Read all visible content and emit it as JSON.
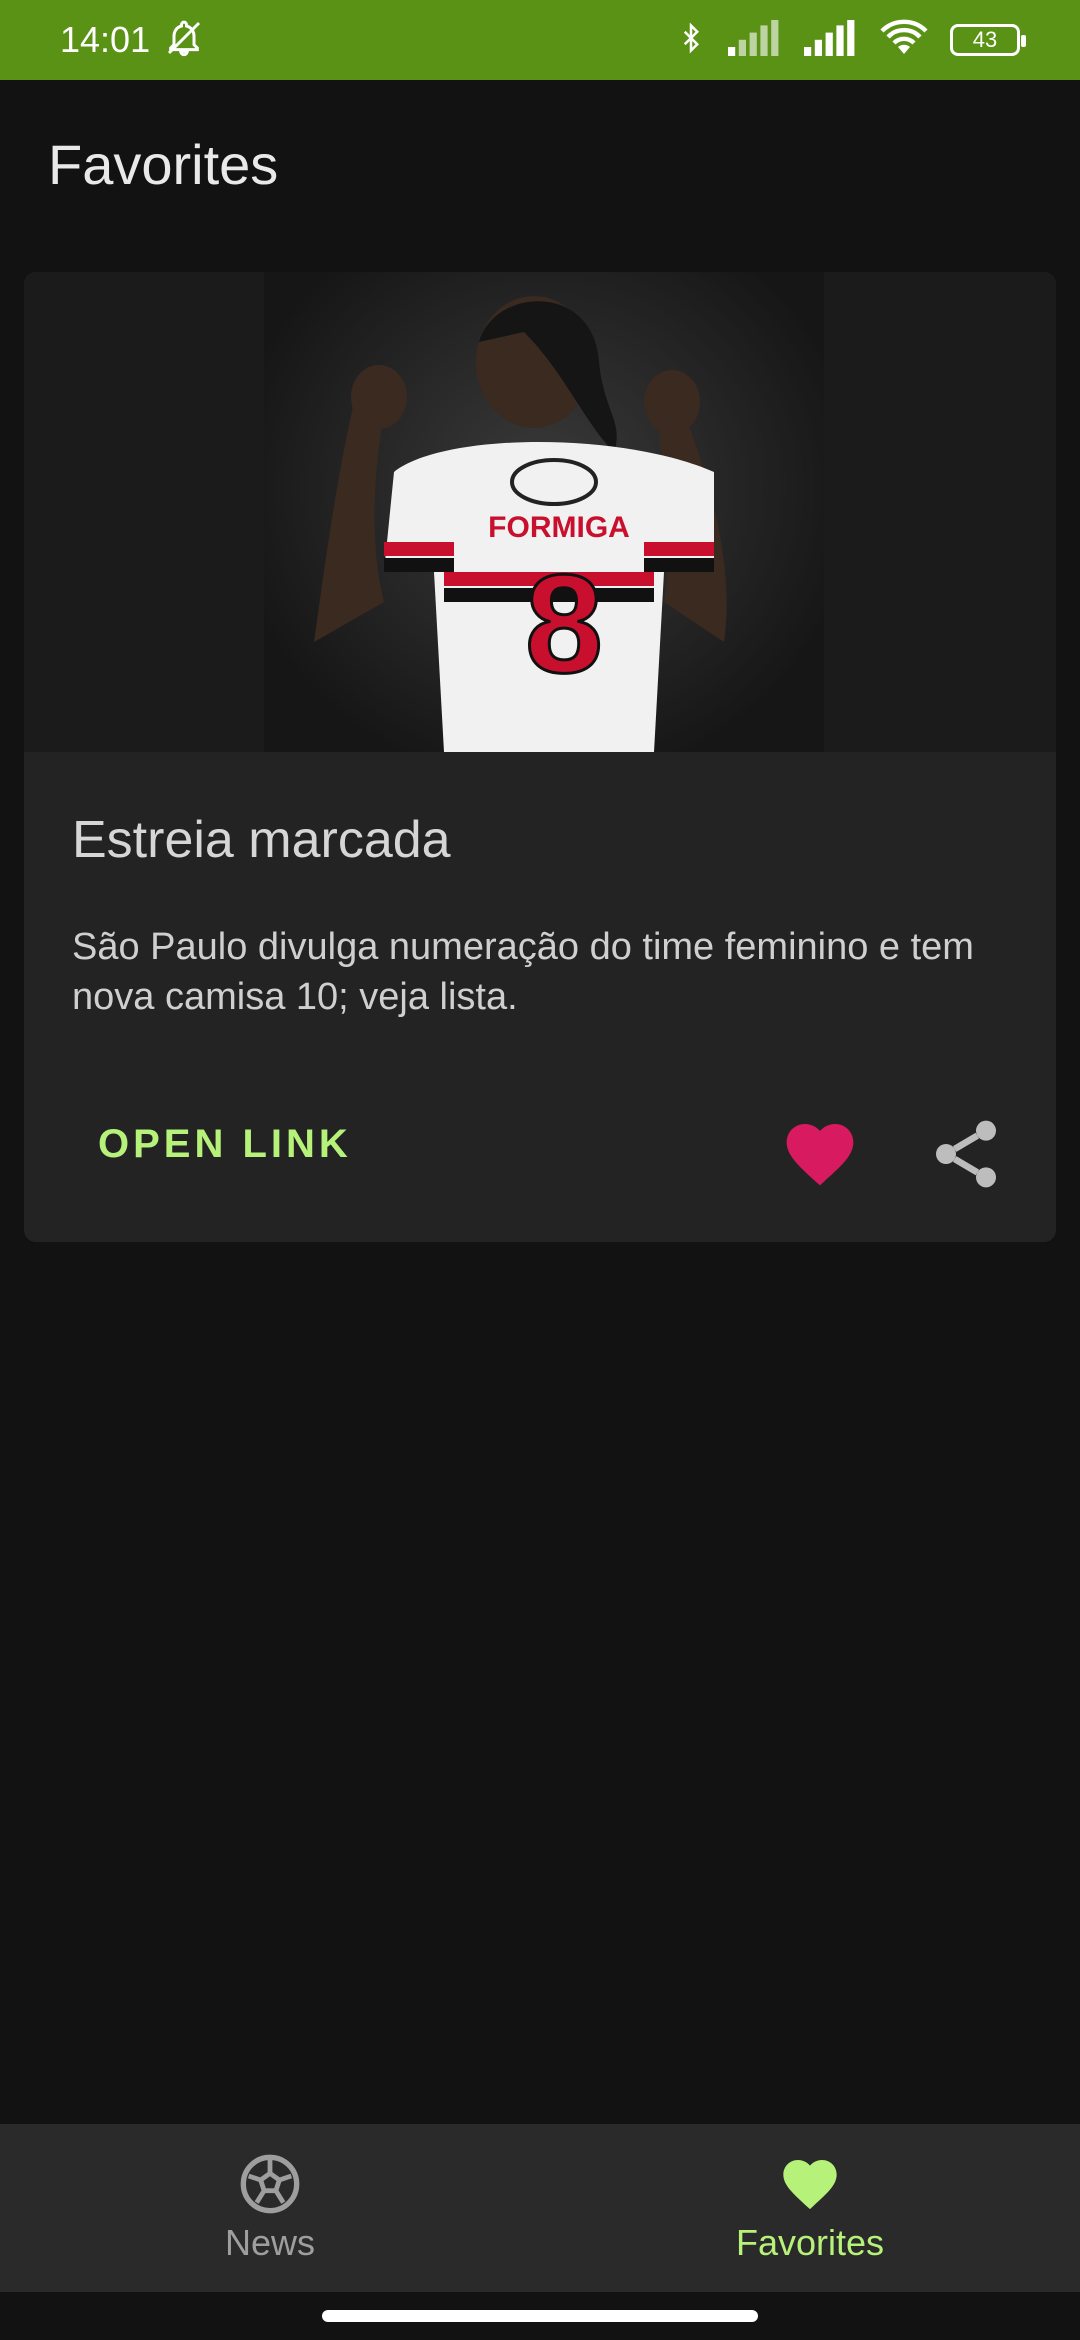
{
  "status_bar": {
    "time": "14:01",
    "battery": "43",
    "icons": [
      "bell-off-icon",
      "bluetooth-icon",
      "signal-icon",
      "signal-icon",
      "wifi-icon",
      "battery-icon"
    ]
  },
  "app": {
    "title": "Favorites"
  },
  "card": {
    "image_alt": "Jogadora do São Paulo com a camisa 8",
    "jersey_name": "FORMIGA",
    "jersey_number": "8",
    "title": "Estreia marcada",
    "description": "São Paulo divulga numeração do time feminino e tem nova camisa 10; veja lista.",
    "open_link_label": "OPEN LINK",
    "favorited": true
  },
  "bottom_nav": {
    "items": [
      {
        "label": "News",
        "icon": "soccer-ball-icon",
        "active": false
      },
      {
        "label": "Favorites",
        "icon": "heart-icon",
        "active": true
      }
    ]
  },
  "colors": {
    "status_bar": "#5a9216",
    "accent": "#b6f27a",
    "heart": "#d81b60",
    "background": "#121212",
    "card": "#232323"
  }
}
